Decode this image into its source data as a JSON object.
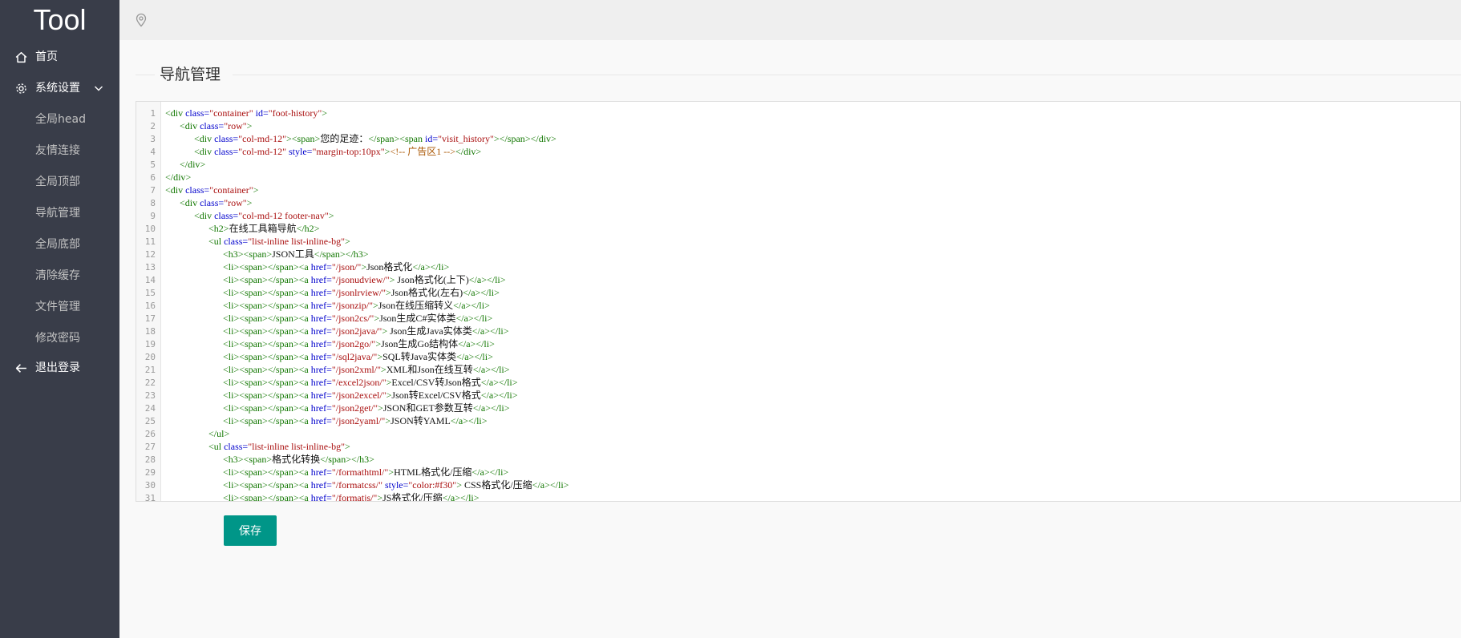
{
  "app": {
    "logo": "Tool"
  },
  "colors": {
    "sidebar_bg": "#393d49",
    "accent": "#009688",
    "topbar_bg": "#efefef"
  },
  "sidebar": {
    "items": [
      {
        "label": "首页",
        "icon": "home-icon"
      },
      {
        "label": "系统设置",
        "icon": "gear-icon",
        "expanded": true,
        "children": [
          {
            "label": "全局head"
          },
          {
            "label": "友情连接"
          },
          {
            "label": "全局顶部"
          },
          {
            "label": "导航管理"
          },
          {
            "label": "全局底部"
          },
          {
            "label": "清除缓存"
          },
          {
            "label": "文件管理"
          },
          {
            "label": "修改密码"
          }
        ]
      },
      {
        "label": "退出登录",
        "icon": "arrow-left-icon"
      }
    ]
  },
  "topbar": {
    "icon": "location-pin-icon"
  },
  "main": {
    "title": "导航管理",
    "editor": {
      "line_numbers": [
        "1",
        "2",
        "3",
        "4",
        "5",
        "6",
        "7",
        "8",
        "9",
        "10",
        "11",
        "12",
        "13",
        "14",
        "15",
        "16",
        "17",
        "18",
        "19",
        "20",
        "21",
        "22",
        "23",
        "24",
        "25",
        "26",
        "27",
        "28",
        "29",
        "30",
        "31"
      ],
      "lines": [
        "<div class=\"container\" id=\"foot-history\">",
        "      <div class=\"row\">",
        "            <div class=\"col-md-12\"><span>您的足迹：</span><span id=\"visit_history\"></span></div>",
        "            <div class=\"col-md-12\" style=\"margin-top:10px\"><!-- 广告区1 --></div>",
        "      </div>",
        "</div>",
        "<div class=\"container\">",
        "      <div class=\"row\">",
        "            <div class=\"col-md-12 footer-nav\">",
        "                  <h2>在线工具箱导航</h2>",
        "                  <ul class=\"list-inline list-inline-bg\">",
        "                        <h3><span>JSON工具</span></h3>",
        "                        <li><span></span><a href=\"/json/\">Json格式化</a></li>",
        "                        <li><span></span><a href=\"/jsonudview/\"> Json格式化(上下)</a></li>",
        "                        <li><span></span><a href=\"/jsonlrview/\">Json格式化(左右)</a></li>",
        "                        <li><span></span><a href=\"/jsonzip/\">Json在线压缩转义</a></li>",
        "                        <li><span></span><a href=\"/json2cs/\">Json生成C#实体类</a></li>",
        "                        <li><span></span><a href=\"/json2java/\"> Json生成Java实体类</a></li>",
        "                        <li><span></span><a href=\"/json2go/\">Json生成Go结构体</a></li>",
        "                        <li><span></span><a href=\"/sql2java/\">SQL转Java实体类</a></li>",
        "                        <li><span></span><a href=\"/json2xml/\">XML和Json在线互转</a></li>",
        "                        <li><span></span><a href=\"/excel2json/\">Excel/CSV转Json格式</a></li>",
        "                        <li><span></span><a href=\"/json2excel/\">Json转Excel/CSV格式</a></li>",
        "                        <li><span></span><a href=\"/json2get/\">JSON和GET参数互转</a></li>",
        "                        <li><span></span><a href=\"/json2yaml/\">JSON转YAML</a></li>",
        "                  </ul>",
        "                  <ul class=\"list-inline list-inline-bg\">",
        "                        <h3><span>格式化转换</span></h3>",
        "                        <li><span></span><a href=\"/formathtml/\">HTML格式化/压缩</a></li>",
        "                        <li><span></span><a href=\"/formatcss/\" style=\"color:#f30\"> CSS格式化/压缩</a></li>",
        "                        <li><span></span><a href=\"/formatjs/\">JS格式化/压缩</a></li>"
      ]
    },
    "save_label": "保存"
  }
}
